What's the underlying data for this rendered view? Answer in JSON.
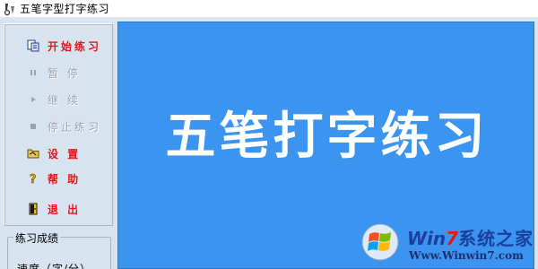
{
  "window": {
    "title": "五笔字型打字练习",
    "icon": "app-wubi-icon"
  },
  "sidebar": {
    "commands": [
      {
        "label": "开始练习",
        "icon": "start-practice-icon",
        "enabled": true
      },
      {
        "label": "暂  停",
        "icon": "pause-icon",
        "enabled": false
      },
      {
        "label": "继  续",
        "icon": "resume-icon",
        "enabled": false
      },
      {
        "label": "停止练习",
        "icon": "stop-icon",
        "enabled": false
      },
      {
        "label": "设  置",
        "icon": "settings-icon",
        "enabled": true
      },
      {
        "label": "帮  助",
        "icon": "help-icon",
        "enabled": true
      },
      {
        "label": "退  出",
        "icon": "exit-icon",
        "enabled": true
      }
    ],
    "score_group": {
      "legend": "练习成绩",
      "speed_label": "速度（字/分）"
    }
  },
  "stage": {
    "headline": "五笔打字练习"
  },
  "watermark": {
    "brand_win": "Win",
    "brand_seven": "7",
    "brand_cn": "系统之家",
    "url": "Www.Winwin7.com"
  },
  "colors": {
    "accent_red": "#e8141c",
    "stage_blue": "#3b95f0",
    "panel": "#d8e3f0"
  }
}
